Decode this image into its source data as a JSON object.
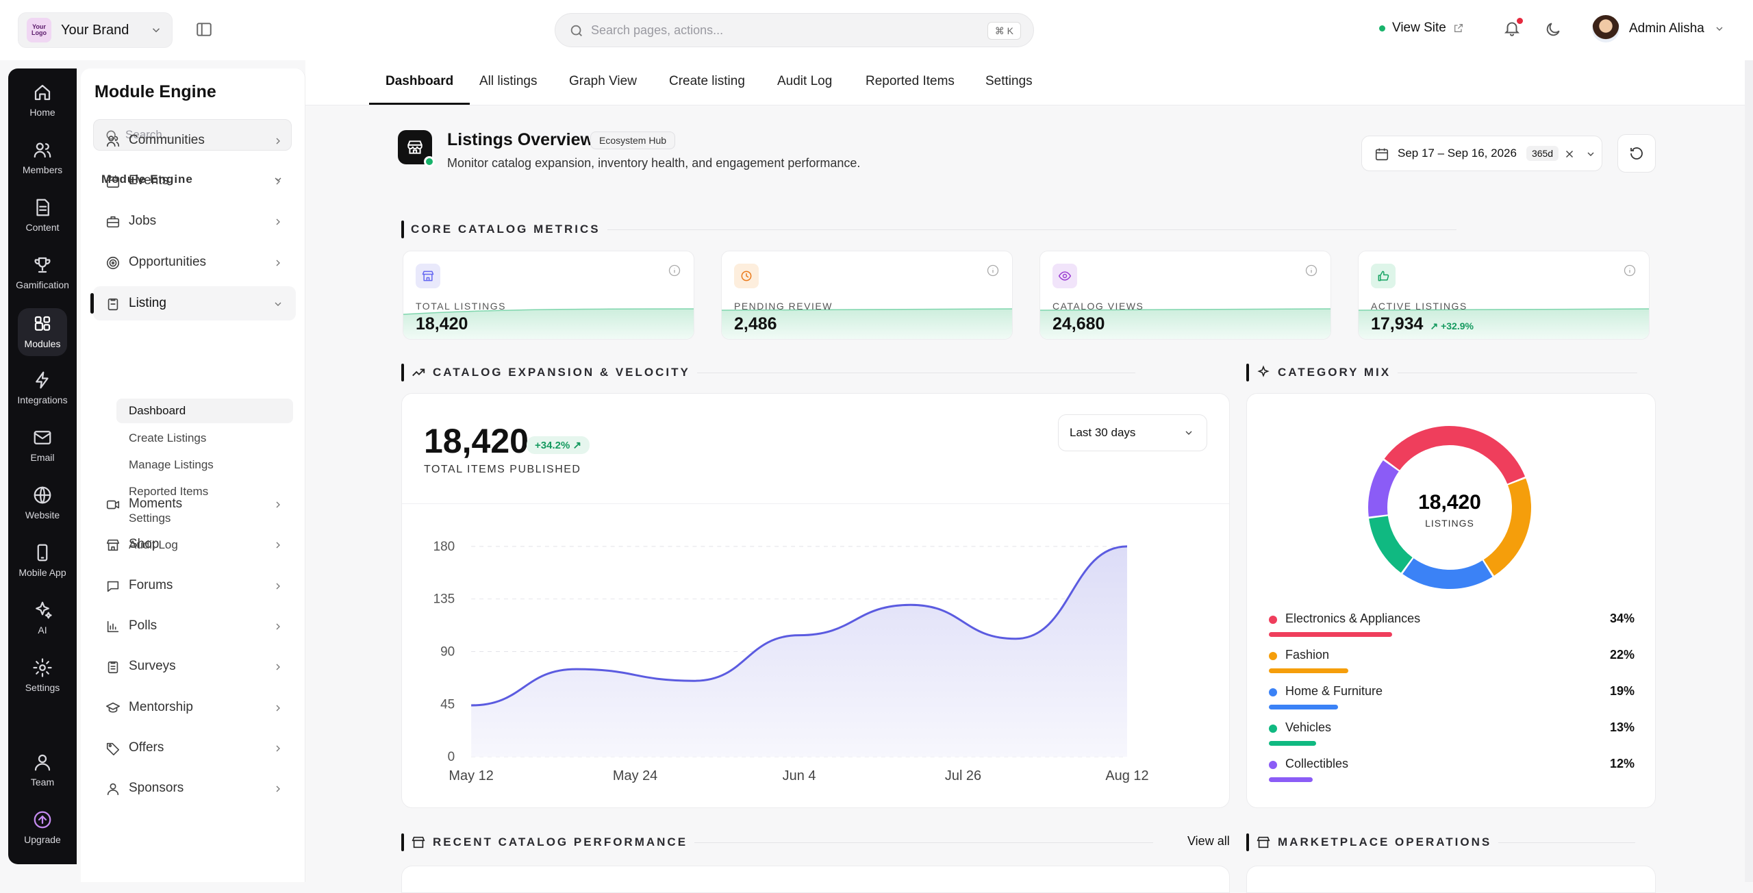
{
  "brand": {
    "logo_text": "Your Logo",
    "name": "Your Brand"
  },
  "search": {
    "placeholder": "Search pages, actions...",
    "shortcut": "⌘ K"
  },
  "topbar": {
    "view_site": "View Site",
    "user_name": "Admin Alisha"
  },
  "rail": [
    {
      "label": "Home",
      "icon": "home-icon"
    },
    {
      "label": "Members",
      "icon": "members-icon"
    },
    {
      "label": "Content",
      "icon": "content-icon"
    },
    {
      "label": "Gamification",
      "icon": "trophy-icon"
    },
    {
      "label": "Modules",
      "icon": "modules-icon",
      "active": true
    },
    {
      "label": "Integrations",
      "icon": "bolt-icon"
    },
    {
      "label": "Email",
      "icon": "mail-icon"
    },
    {
      "label": "Website",
      "icon": "globe-icon"
    },
    {
      "label": "Mobile App",
      "icon": "phone-icon"
    },
    {
      "label": "AI",
      "icon": "sparkle-icon"
    },
    {
      "label": "Settings",
      "icon": "gear-icon"
    },
    {
      "label": "Team",
      "icon": "team-icon"
    },
    {
      "label": "Upgrade",
      "icon": "upgrade-icon"
    }
  ],
  "nav": {
    "title": "Module Engine",
    "search_placeholder": "Search...",
    "section": "Module Engine",
    "items": [
      {
        "label": "Communities",
        "icon": "users-icon"
      },
      {
        "label": "Events",
        "icon": "calendar-icon"
      },
      {
        "label": "Jobs",
        "icon": "briefcase-icon"
      },
      {
        "label": "Opportunities",
        "icon": "target-icon"
      },
      {
        "label": "Listing",
        "icon": "listing-icon",
        "open": true
      },
      {
        "label": "Moments",
        "icon": "video-icon"
      },
      {
        "label": "Shop",
        "icon": "shop-icon"
      },
      {
        "label": "Forums",
        "icon": "chat-icon"
      },
      {
        "label": "Polls",
        "icon": "chart-icon"
      },
      {
        "label": "Surveys",
        "icon": "clipboard-icon"
      },
      {
        "label": "Mentorship",
        "icon": "graduation-icon"
      },
      {
        "label": "Offers",
        "icon": "tag-icon"
      },
      {
        "label": "Sponsors",
        "icon": "team-icon"
      }
    ],
    "sub": [
      "Dashboard",
      "Create Listings",
      "Manage Listings",
      "Reported Items",
      "Settings",
      "Audit Log"
    ]
  },
  "tabs": [
    "Dashboard",
    "All listings",
    "Graph View",
    "Create listing",
    "Audit Log",
    "Reported Items",
    "Settings"
  ],
  "header": {
    "title": "Listings Overview",
    "badge": "Ecosystem Hub",
    "subtitle": "Monitor catalog expansion, inventory health, and engagement performance.",
    "date_range": "Sep 17 – Sep 16, 2026",
    "days": "365d"
  },
  "sections": {
    "core": "CORE CATALOG METRICS",
    "velocity": "CATALOG EXPANSION & VELOCITY",
    "mix": "CATEGORY MIX",
    "recent": "RECENT CATALOG PERFORMANCE",
    "ops": "MARKETPLACE OPERATIONS",
    "view_all": "View all"
  },
  "metrics": [
    {
      "label": "TOTAL LISTINGS",
      "value": "18,420",
      "icon": "store-icon",
      "color": "#6366f1",
      "bg": "#e9e9fb"
    },
    {
      "label": "PENDING REVIEW",
      "value": "2,486",
      "icon": "clock-icon",
      "color": "#ea7a1b",
      "bg": "#fdeedd"
    },
    {
      "label": "CATALOG VIEWS",
      "value": "24,680",
      "icon": "eye-icon",
      "color": "#9b3fd1",
      "bg": "#f1e4fa"
    },
    {
      "label": "ACTIVE LISTINGS",
      "value": "17,934",
      "change": "+32.9%",
      "icon": "thumbs-up-icon",
      "color": "#17a463",
      "bg": "#def5e9"
    }
  ],
  "velocity": {
    "total": "18,420",
    "change": "+34.2%",
    "label": "TOTAL ITEMS PUBLISHED",
    "range": "Last 30 days"
  },
  "chart_data": {
    "type": "area",
    "x": [
      "May 12",
      "May 24",
      "Jun 4",
      "Jul 26",
      "Aug 12"
    ],
    "yticks": [
      0,
      45,
      90,
      135,
      180
    ],
    "ylim": [
      0,
      180
    ],
    "points": [
      [
        0,
        44
      ],
      [
        0.16,
        75
      ],
      [
        0.34,
        65
      ],
      [
        0.5,
        104
      ],
      [
        0.67,
        130
      ],
      [
        0.83,
        101
      ],
      [
        1,
        180
      ]
    ],
    "color": "#5b5be0"
  },
  "category_mix": {
    "total": "18,420",
    "total_label": "LISTINGS",
    "items": [
      {
        "name": "Electronics & Appliances",
        "pct": 34,
        "label": "34%",
        "color": "#ef3e5c"
      },
      {
        "name": "Fashion",
        "pct": 22,
        "label": "22%",
        "color": "#f59e0b"
      },
      {
        "name": "Home & Furniture",
        "pct": 19,
        "label": "19%",
        "color": "#3b82f6"
      },
      {
        "name": "Vehicles",
        "pct": 13,
        "label": "13%",
        "color": "#10b981"
      },
      {
        "name": "Collectibles",
        "pct": 12,
        "label": "12%",
        "color": "#8b5cf6"
      }
    ]
  }
}
